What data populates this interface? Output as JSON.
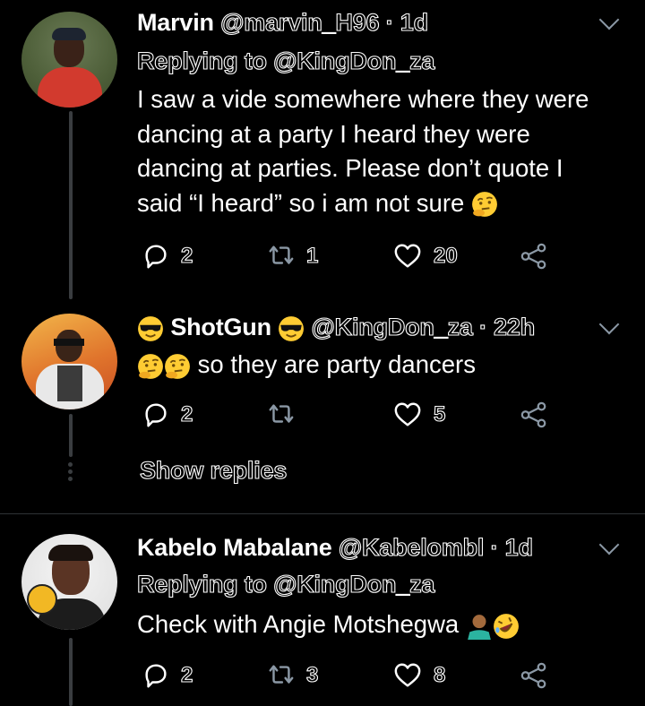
{
  "tweets": [
    {
      "name": "Marvin",
      "handle": "@marvin_H96",
      "time": "· 1d",
      "replying": "Replying to @KingDon_za",
      "lines": [
        "I saw a vide somewhere where they were",
        "dancing at a party I heard they were",
        "dancing at parties. Please don’t quote I",
        "said “I heard” so i am not sure"
      ],
      "replies": "2",
      "retweets": "1",
      "likes": "20"
    },
    {
      "name": "ShotGun",
      "handle": "@KingDon_za",
      "time": "· 22h",
      "text": "so they are party dancers",
      "replies": "2",
      "retweets": "",
      "likes": "5",
      "show_replies": "Show replies"
    },
    {
      "name": "Kabelo Mabalane",
      "handle": "@Kabelombl",
      "time": "· 1d",
      "replying": "Replying to @KingDon_za",
      "text": "Check with Angie Motshegwa",
      "replies": "2",
      "retweets": "3",
      "likes": "8"
    }
  ],
  "icons": {
    "reply": "reply-icon",
    "retweet": "retweet-icon",
    "like": "heart-icon",
    "share": "share-icon",
    "menu": "chevron-down-icon",
    "thinking": "thinking-face-emoji",
    "sunglasses": "sunglasses-emoji",
    "shrug": "person-shrugging-emoji",
    "rofl": "rofl-emoji"
  },
  "colors": {
    "background": "#000000",
    "thread_line": "#3a3d40",
    "icon_gray": "#8b98a5"
  }
}
